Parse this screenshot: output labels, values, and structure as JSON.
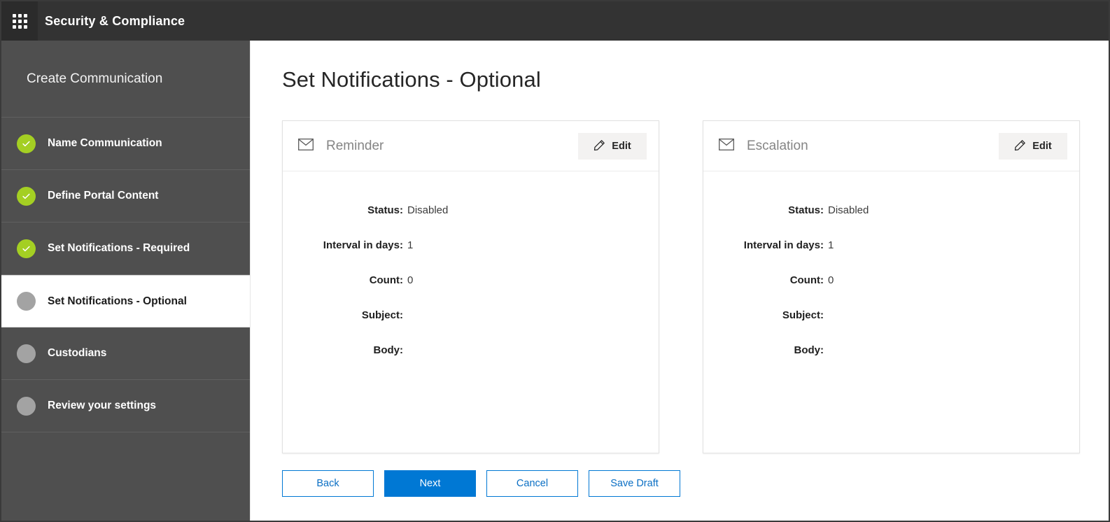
{
  "topbar": {
    "waffle_icon": "app-launcher-waffle-icon",
    "title": "Security & Compliance"
  },
  "sidebar": {
    "heading": "Create Communication",
    "items": [
      {
        "label": "Name Communication",
        "state": "done"
      },
      {
        "label": "Define Portal Content",
        "state": "done"
      },
      {
        "label": "Set Notifications - Required",
        "state": "done"
      },
      {
        "label": "Set Notifications - Optional",
        "state": "current"
      },
      {
        "label": "Custodians",
        "state": "pending"
      },
      {
        "label": "Review your settings",
        "state": "pending"
      }
    ],
    "colors": {
      "done": "#a4cf23",
      "pending": "#a3a3a3",
      "background": "#4f4f4f"
    }
  },
  "main": {
    "page_title": "Set Notifications - Optional",
    "cards": [
      {
        "icon": "envelope-icon",
        "title": "Reminder",
        "edit_label": "Edit",
        "edit_icon": "pencil-icon",
        "fields": [
          {
            "label": "Status:",
            "value": "Disabled"
          },
          {
            "label": "Interval in days:",
            "value": "1"
          },
          {
            "label": "Count:",
            "value": "0"
          },
          {
            "label": "Subject:",
            "value": ""
          },
          {
            "label": "Body:",
            "value": ""
          }
        ]
      },
      {
        "icon": "envelope-icon",
        "title": "Escalation",
        "edit_label": "Edit",
        "edit_icon": "pencil-icon",
        "fields": [
          {
            "label": "Status:",
            "value": "Disabled"
          },
          {
            "label": "Interval in days:",
            "value": "1"
          },
          {
            "label": "Count:",
            "value": "0"
          },
          {
            "label": "Subject:",
            "value": ""
          },
          {
            "label": "Body:",
            "value": ""
          }
        ]
      }
    ],
    "actions": [
      {
        "label": "Back",
        "style": "secondary"
      },
      {
        "label": "Next",
        "style": "primary"
      },
      {
        "label": "Cancel",
        "style": "secondary"
      },
      {
        "label": "Save Draft",
        "style": "secondary"
      }
    ],
    "accent_color": "#0078d4"
  }
}
